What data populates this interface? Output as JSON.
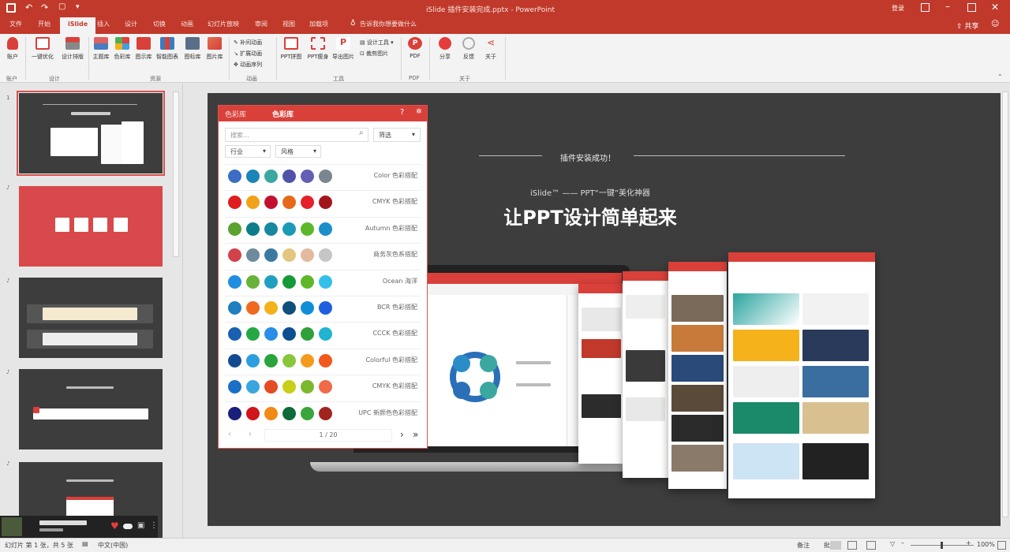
{
  "titlebar": {
    "doc_title": "iSlide 插件安装完成.pptx - PowerPoint",
    "user": "登录"
  },
  "tabs": [
    "文件",
    "开始",
    "iSlide",
    "插入",
    "设计",
    "切换",
    "动画",
    "幻灯片放映",
    "审阅",
    "视图",
    "加载项",
    "告诉我你想要做什么"
  ],
  "ribbon": {
    "account": "账户",
    "design_group": [
      "一键优化",
      "设计排版"
    ],
    "libs": [
      "主题库",
      "色彩库",
      "图示库",
      "智能图表",
      "图标库",
      "图片库"
    ],
    "anim": [
      "补间动画",
      "扩展动画",
      "动画序列"
    ],
    "tools": [
      "PPT拼图",
      "PPT瘦身",
      "导出图片"
    ],
    "tool_small": [
      "设计工具",
      "裁剪图片"
    ],
    "share": [
      "分享",
      "反馈",
      "关于"
    ],
    "groups": [
      "账户",
      "设计",
      "资源",
      "动画",
      "工具",
      "PDF",
      "关于"
    ],
    "pdf": "PDF"
  },
  "slide": {
    "heading": "插件安装成功！",
    "subtitle": "iSlide™ —— PPT“一键”美化神器",
    "main_title": "让PPT设计简单起来"
  },
  "panel": {
    "tab1": "色彩库",
    "tab2": "色彩库",
    "help": "?",
    "search_placeholder": "搜索...",
    "filter_label": "筛选",
    "dd1": "行业",
    "dd2": "风格",
    "palettes": [
      {
        "name": "Color 色彩搭配",
        "colors": [
          "#3b6ec2",
          "#1b85b8",
          "#3aa7a0",
          "#5052a8",
          "#6160b5",
          "#7a8690"
        ]
      },
      {
        "name": "CMYK 色彩搭配",
        "colors": [
          "#e01d1d",
          "#f2a21a",
          "#c5102d",
          "#e8681a",
          "#e5202a",
          "#a3151c"
        ]
      },
      {
        "name": "Autumn 色彩搭配",
        "colors": [
          "#5aa12f",
          "#0d7d8a",
          "#17889f",
          "#1a9bb5",
          "#5cb82a",
          "#1c8ec9"
        ]
      },
      {
        "name": "商务灰色系搭配",
        "colors": [
          "#d2424a",
          "#6d8b9c",
          "#3b7aa0",
          "#e3c680",
          "#e3b9a0",
          "#c6c6c6"
        ]
      },
      {
        "name": "Ocean 海洋",
        "colors": [
          "#1f8ee0",
          "#68b23a",
          "#1fa0c0",
          "#159a3a",
          "#5cb82a",
          "#33c0e8"
        ]
      },
      {
        "name": "BCR 色彩搭配",
        "colors": [
          "#1f7fc0",
          "#ef6a20",
          "#f1b21a",
          "#0e4f7c",
          "#0f8ed8",
          "#1e5fe0"
        ]
      },
      {
        "name": "CCCK 色彩搭配",
        "colors": [
          "#1a5fb0",
          "#24a844",
          "#2a8de8",
          "#0c4f8e",
          "#2fa13a",
          "#1fb4d0"
        ]
      },
      {
        "name": "Colorful 色彩搭配",
        "colors": [
          "#134b92",
          "#2b9fe0",
          "#2aa43c",
          "#8ac63c",
          "#f59a1a",
          "#f2581a"
        ]
      },
      {
        "name": "CMYK 色彩搭配",
        "colors": [
          "#1b6fc5",
          "#3aa6e0",
          "#e54b24",
          "#c8cf16",
          "#7ab82e",
          "#f06a4a"
        ]
      },
      {
        "name": "UPC 新颜色色彩搭配",
        "colors": [
          "#1a1f7a",
          "#d0161c",
          "#f08a12",
          "#0f6a3a",
          "#3aa53a",
          "#a1241f"
        ]
      }
    ],
    "page": "1 / 20"
  },
  "status": {
    "slide_info": "幻灯片 第 1 张，共 5 张",
    "lang": "中文(中国)",
    "notes": "备注",
    "comments": "批注",
    "zoom": "100%"
  }
}
